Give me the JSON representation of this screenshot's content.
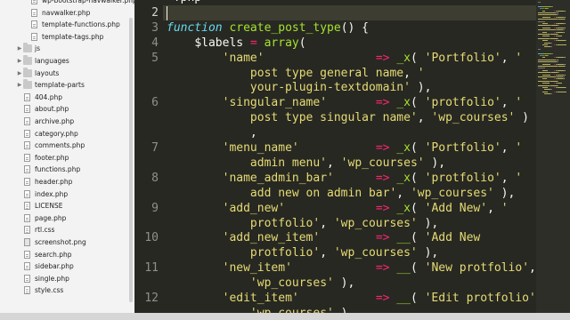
{
  "sidebar": {
    "items": [
      {
        "type": "file",
        "icon": "php-file-icon",
        "label": "wp-bootstrap-navwalker.php",
        "indent": 2
      },
      {
        "type": "file",
        "icon": "php-file-icon",
        "label": "navwalker.php",
        "indent": 2
      },
      {
        "type": "file",
        "icon": "php-file-icon",
        "label": "template-functions.php",
        "indent": 2
      },
      {
        "type": "file",
        "icon": "php-file-icon",
        "label": "template-tags.php",
        "indent": 2
      },
      {
        "type": "folder",
        "icon": "folder-icon",
        "label": "js",
        "indent": 1
      },
      {
        "type": "folder",
        "icon": "folder-icon",
        "label": "languages",
        "indent": 1
      },
      {
        "type": "folder",
        "icon": "folder-icon",
        "label": "layouts",
        "indent": 1
      },
      {
        "type": "folder",
        "icon": "folder-icon",
        "label": "template-parts",
        "indent": 1
      },
      {
        "type": "file",
        "icon": "php-file-icon",
        "label": "404.php",
        "indent": 1
      },
      {
        "type": "file",
        "icon": "php-file-icon",
        "label": "about.php",
        "indent": 1
      },
      {
        "type": "file",
        "icon": "php-file-icon",
        "label": "archive.php",
        "indent": 1
      },
      {
        "type": "file",
        "icon": "php-file-icon",
        "label": "category.php",
        "indent": 1
      },
      {
        "type": "file",
        "icon": "php-file-icon",
        "label": "comments.php",
        "indent": 1
      },
      {
        "type": "file",
        "icon": "php-file-icon",
        "label": "footer.php",
        "indent": 1
      },
      {
        "type": "file",
        "icon": "php-file-icon",
        "label": "functions.php",
        "indent": 1
      },
      {
        "type": "file",
        "icon": "php-file-icon",
        "label": "header.php",
        "indent": 1
      },
      {
        "type": "file",
        "icon": "php-file-icon",
        "label": "index.php",
        "indent": 1
      },
      {
        "type": "file",
        "icon": "text-file-icon",
        "label": "LICENSE",
        "indent": 1
      },
      {
        "type": "file",
        "icon": "php-file-icon",
        "label": "page.php",
        "indent": 1
      },
      {
        "type": "file",
        "icon": "css-file-icon",
        "label": "rtl.css",
        "indent": 1
      },
      {
        "type": "file",
        "icon": "image-file-icon",
        "label": "screenshot.png",
        "indent": 1
      },
      {
        "type": "file",
        "icon": "php-file-icon",
        "label": "search.php",
        "indent": 1
      },
      {
        "type": "file",
        "icon": "php-file-icon",
        "label": "sidebar.php",
        "indent": 1
      },
      {
        "type": "file",
        "icon": "php-file-icon",
        "label": "single.php",
        "indent": 1
      },
      {
        "type": "file",
        "icon": "css-file-icon",
        "label": "style.css",
        "indent": 1
      }
    ]
  },
  "editor": {
    "current_line": "2",
    "lines": [
      {
        "num": "",
        "text": [
          [
            "pn",
            "<?php"
          ]
        ]
      },
      {
        "num": "2",
        "text": []
      },
      {
        "num": "3",
        "text": [
          [
            "kw",
            "function"
          ],
          [
            "pn",
            " "
          ],
          [
            "fn",
            "create_post_type"
          ],
          [
            "pn",
            "() {"
          ]
        ]
      },
      {
        "num": "4",
        "text": [
          [
            "pn",
            "    "
          ],
          [
            "var",
            "$labels"
          ],
          [
            "pn",
            " "
          ],
          [
            "op",
            "="
          ],
          [
            "pn",
            " "
          ],
          [
            "fn",
            "array"
          ],
          [
            "pn",
            "("
          ]
        ]
      },
      {
        "num": "5",
        "text": [
          [
            "pn",
            "        "
          ],
          [
            "str",
            "'name'"
          ],
          [
            "pn",
            "                "
          ],
          [
            "op",
            "=>"
          ],
          [
            "pn",
            " "
          ],
          [
            "fn",
            "_x"
          ],
          [
            "pn",
            "( "
          ],
          [
            "str",
            "'Portfolio'"
          ],
          [
            "pn",
            ", "
          ],
          [
            "str",
            "'"
          ]
        ]
      },
      {
        "num": "",
        "text": [
          [
            "str",
            "            post type general name"
          ],
          [
            "pn",
            ", "
          ],
          [
            "str",
            "'"
          ]
        ]
      },
      {
        "num": "",
        "text": [
          [
            "str",
            "            your-plugin-textdomain'"
          ],
          [
            "pn",
            " ),"
          ]
        ]
      },
      {
        "num": "6",
        "text": [
          [
            "pn",
            "        "
          ],
          [
            "str",
            "'singular_name'"
          ],
          [
            "pn",
            "       "
          ],
          [
            "op",
            "=>"
          ],
          [
            "pn",
            " "
          ],
          [
            "fn",
            "_x"
          ],
          [
            "pn",
            "( "
          ],
          [
            "str",
            "'protfolio'"
          ],
          [
            "pn",
            ", "
          ],
          [
            "str",
            "'"
          ]
        ]
      },
      {
        "num": "",
        "text": [
          [
            "str",
            "            post type singular name'"
          ],
          [
            "pn",
            ", "
          ],
          [
            "str",
            "'wp_courses'"
          ],
          [
            "pn",
            " )"
          ]
        ]
      },
      {
        "num": "",
        "text": [
          [
            "pn",
            "            ,"
          ]
        ]
      },
      {
        "num": "7",
        "text": [
          [
            "pn",
            "        "
          ],
          [
            "str",
            "'menu_name'"
          ],
          [
            "pn",
            "           "
          ],
          [
            "op",
            "=>"
          ],
          [
            "pn",
            " "
          ],
          [
            "fn",
            "_x"
          ],
          [
            "pn",
            "( "
          ],
          [
            "str",
            "'Portfolio'"
          ],
          [
            "pn",
            ", "
          ],
          [
            "str",
            "'"
          ]
        ]
      },
      {
        "num": "",
        "text": [
          [
            "str",
            "            admin menu'"
          ],
          [
            "pn",
            ", "
          ],
          [
            "str",
            "'wp_courses'"
          ],
          [
            "pn",
            " ),"
          ]
        ]
      },
      {
        "num": "8",
        "text": [
          [
            "pn",
            "        "
          ],
          [
            "str",
            "'name_admin_bar'"
          ],
          [
            "pn",
            "      "
          ],
          [
            "op",
            "=>"
          ],
          [
            "pn",
            " "
          ],
          [
            "fn",
            "_x"
          ],
          [
            "pn",
            "( "
          ],
          [
            "str",
            "'protfolio'"
          ],
          [
            "pn",
            ", "
          ],
          [
            "str",
            "'"
          ]
        ]
      },
      {
        "num": "",
        "text": [
          [
            "str",
            "            add new on admin bar'"
          ],
          [
            "pn",
            ", "
          ],
          [
            "str",
            "'wp_courses'"
          ],
          [
            "pn",
            " ),"
          ]
        ]
      },
      {
        "num": "9",
        "text": [
          [
            "pn",
            "        "
          ],
          [
            "str",
            "'add_new'"
          ],
          [
            "pn",
            "             "
          ],
          [
            "op",
            "=>"
          ],
          [
            "pn",
            " "
          ],
          [
            "fn",
            "_x"
          ],
          [
            "pn",
            "( "
          ],
          [
            "str",
            "'Add New'"
          ],
          [
            "pn",
            ", "
          ],
          [
            "str",
            "'"
          ]
        ]
      },
      {
        "num": "",
        "text": [
          [
            "str",
            "            protfolio'"
          ],
          [
            "pn",
            ", "
          ],
          [
            "str",
            "'wp_courses'"
          ],
          [
            "pn",
            " ),"
          ]
        ]
      },
      {
        "num": "10",
        "text": [
          [
            "pn",
            "        "
          ],
          [
            "str",
            "'add_new_item'"
          ],
          [
            "pn",
            "        "
          ],
          [
            "op",
            "=>"
          ],
          [
            "pn",
            " "
          ],
          [
            "fn",
            "__"
          ],
          [
            "pn",
            "( "
          ],
          [
            "str",
            "'Add New"
          ]
        ]
      },
      {
        "num": "",
        "text": [
          [
            "str",
            "            protfolio'"
          ],
          [
            "pn",
            ", "
          ],
          [
            "str",
            "'wp_courses'"
          ],
          [
            "pn",
            " ),"
          ]
        ]
      },
      {
        "num": "11",
        "text": [
          [
            "pn",
            "        "
          ],
          [
            "str",
            "'new_item'"
          ],
          [
            "pn",
            "            "
          ],
          [
            "op",
            "=>"
          ],
          [
            "pn",
            " "
          ],
          [
            "fn",
            "__"
          ],
          [
            "pn",
            "( "
          ],
          [
            "str",
            "'New protfolio'"
          ],
          [
            "pn",
            ","
          ]
        ]
      },
      {
        "num": "",
        "text": [
          [
            "pn",
            "            "
          ],
          [
            "str",
            "'wp_courses'"
          ],
          [
            "pn",
            " ),"
          ]
        ]
      },
      {
        "num": "12",
        "text": [
          [
            "pn",
            "        "
          ],
          [
            "str",
            "'edit_item'"
          ],
          [
            "pn",
            "           "
          ],
          [
            "op",
            "=>"
          ],
          [
            "pn",
            " "
          ],
          [
            "fn",
            "__"
          ],
          [
            "pn",
            "( "
          ],
          [
            "str",
            "'Edit protfolio'"
          ]
        ]
      },
      {
        "num": "",
        "text": [
          [
            "pn",
            "            "
          ],
          [
            "str",
            "'wp_courses'"
          ],
          [
            "pn",
            " ),"
          ]
        ]
      }
    ]
  },
  "colors": {
    "editor_bg": "#272822",
    "keyword": "#66d9ef",
    "function": "#a6e22e",
    "operator": "#f92672",
    "string": "#e6db74",
    "text": "#f8f8f2",
    "sidebar_bg": "#f3f3f3"
  }
}
